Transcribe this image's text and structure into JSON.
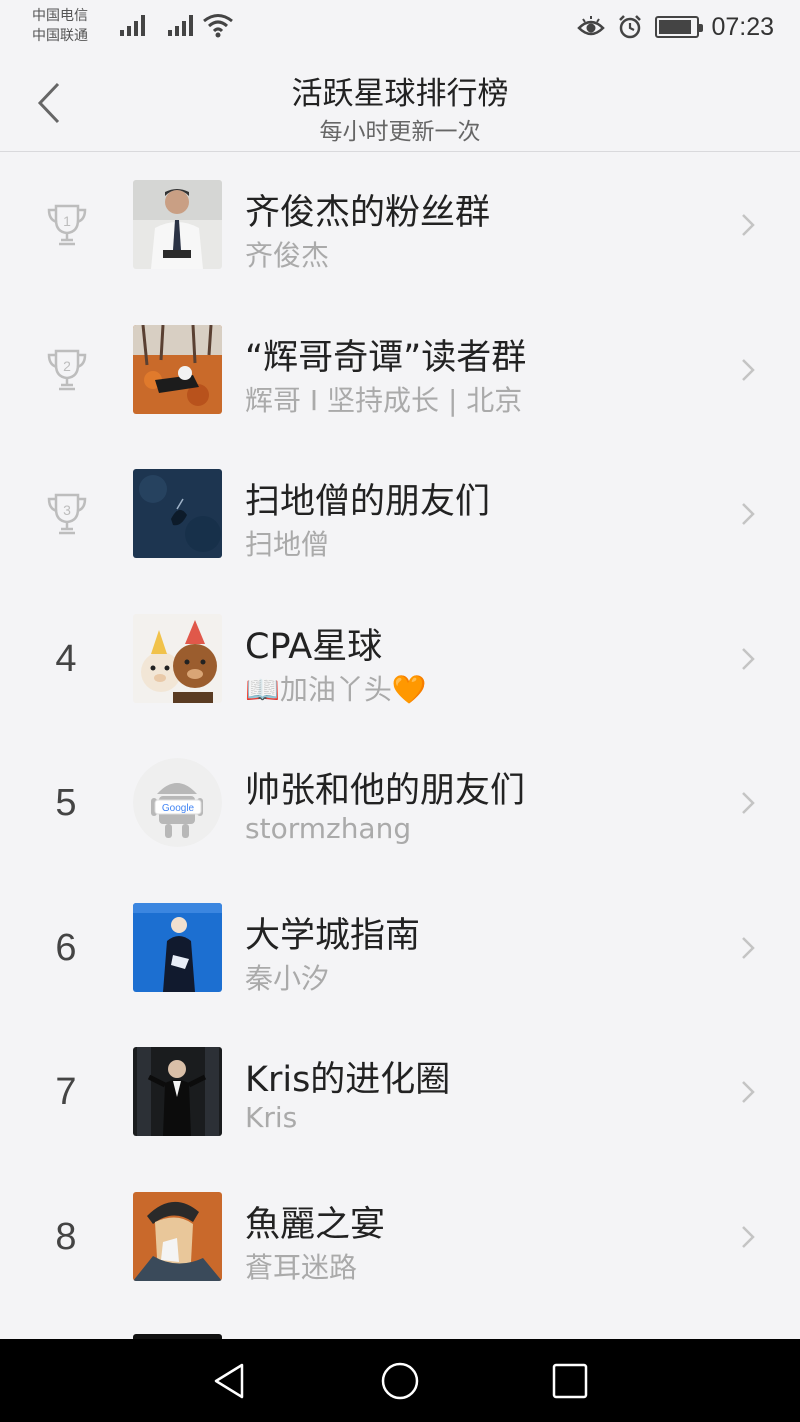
{
  "status_bar": {
    "carrier1": "中国电信",
    "carrier2": "中国联通",
    "time": "07:23",
    "battery_level": 0.9,
    "icons": [
      "signal-icon",
      "signal-icon",
      "wifi-icon",
      "eye-icon",
      "alarm-icon",
      "battery-icon"
    ]
  },
  "header": {
    "title": "活跃星球排行榜",
    "subtitle": "每小时更新一次",
    "back_icon": "chevron-left-icon"
  },
  "list": [
    {
      "rank": "1",
      "trophy": true,
      "name": "齐俊杰的粉丝群",
      "owner": "齐俊杰"
    },
    {
      "rank": "2",
      "trophy": true,
      "name": "“辉哥奇谭”读者群",
      "owner": "辉哥 I 坚持成长 | 北京"
    },
    {
      "rank": "3",
      "trophy": true,
      "name": "扫地僧的朋友们",
      "owner": "扫地僧"
    },
    {
      "rank": "4",
      "trophy": false,
      "name": "CPA星球",
      "owner": "📖加油丫头🧡"
    },
    {
      "rank": "5",
      "trophy": false,
      "name": "帅张和他的朋友们",
      "owner": "stormzhang"
    },
    {
      "rank": "6",
      "trophy": false,
      "name": "大学城指南",
      "owner": "秦小汐"
    },
    {
      "rank": "7",
      "trophy": false,
      "name": "Kris的进化圈",
      "owner": "Kris"
    },
    {
      "rank": "8",
      "trophy": false,
      "name": "魚麗之宴",
      "owner": "蒼耳迷路"
    }
  ],
  "colors": {
    "background": "#f4f4f6",
    "trophy": "#bdbdbd",
    "secondary_text": "#aaaaaa",
    "nav_bar": "#000000"
  },
  "nav_bar": {
    "icons": [
      "back-triangle-icon",
      "home-circle-icon",
      "recents-square-icon"
    ]
  }
}
